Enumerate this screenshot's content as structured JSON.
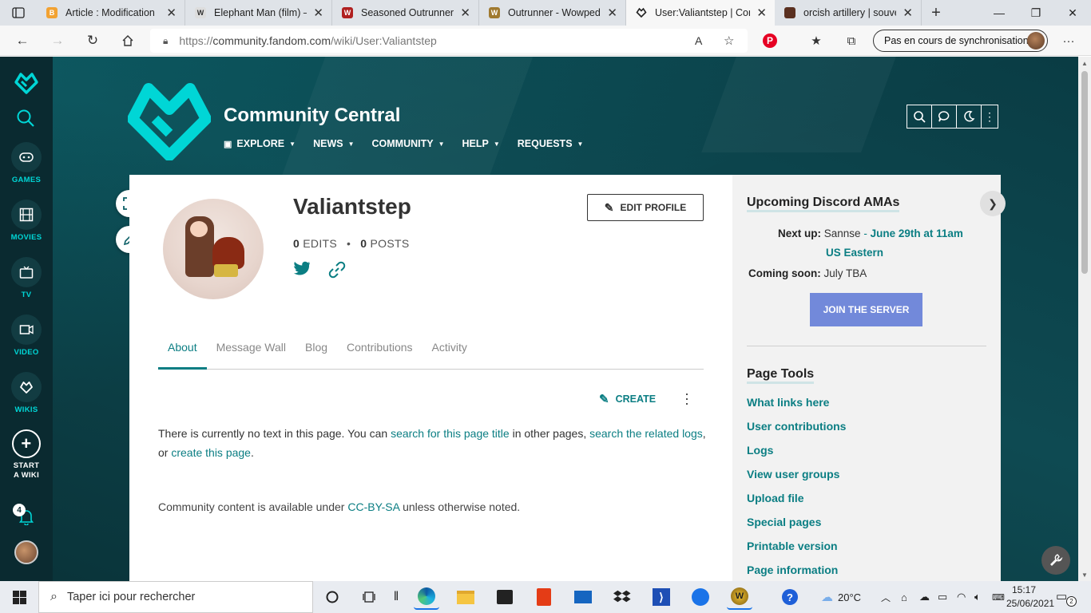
{
  "browser": {
    "tabs": [
      {
        "title": "Article : Modification",
        "favicon_color": "#f2a232"
      },
      {
        "title": "Elephant Man (film) — Wikipédia",
        "favicon_color": "#dddddd"
      },
      {
        "title": "Seasoned Outrunner - Wowpedia",
        "favicon_color": "#b02020"
      },
      {
        "title": "Outrunner - Wowpedia",
        "favicon_color": "#a07a30"
      },
      {
        "title": "User:Valiantstep | Community Central",
        "favicon_color": "#222222",
        "active": true
      },
      {
        "title": "orcish artillery | souvenirs",
        "favicon_color": "#5a3020"
      }
    ],
    "url_prefix": "https://",
    "url_host": "community.fandom.com",
    "url_path": "/wiki/User:Valiantstep",
    "sync_label": "Pas en cours de synchronisation"
  },
  "global_nav": {
    "items": [
      {
        "label": "GAMES",
        "icon": "gamepad-icon"
      },
      {
        "label": "MOVIES",
        "icon": "film-icon"
      },
      {
        "label": "TV",
        "icon": "tv-icon"
      },
      {
        "label": "VIDEO",
        "icon": "video-icon"
      },
      {
        "label": "WIKIS",
        "icon": "fandom-heart-icon"
      },
      {
        "label": "START A WIKI",
        "icon": "plus-icon"
      }
    ],
    "notifications_count": "4"
  },
  "community": {
    "title": "Community Central",
    "nav": [
      "EXPLORE",
      "NEWS",
      "COMMUNITY",
      "HELP",
      "REQUESTS"
    ]
  },
  "profile": {
    "username": "Valiantstep",
    "edits_count": "0",
    "edits_label": "EDITS",
    "posts_count": "0",
    "posts_label": "POSTS",
    "edit_profile_label": "EDIT PROFILE"
  },
  "tabs": [
    "About",
    "Message Wall",
    "Blog",
    "Contributions",
    "Activity"
  ],
  "content": {
    "create_label": "CREATE",
    "text_1": "There is currently no text in this page. You can ",
    "link_1": "search for this page title",
    "text_2": " in other pages, ",
    "link_2": "search the related logs",
    "text_3": ", or ",
    "link_3": "create this page",
    "text_4": ".",
    "license_pre": "Community content is available under ",
    "license_link": "CC-BY-SA",
    "license_post": " unless otherwise noted."
  },
  "rail": {
    "amas_title": "Upcoming Discord AMAs",
    "next_up_label": "Next up:",
    "next_up_name": "Sannse",
    "next_up_sep": " - ",
    "next_up_time_1": "June 29th at 11am",
    "next_up_time_2": "US Eastern",
    "coming_soon_label": "Coming soon:",
    "coming_soon_value": "July TBA",
    "join_label": "JOIN THE SERVER",
    "tools_title": "Page Tools",
    "tools": [
      "What links here",
      "User contributions",
      "Logs",
      "View user groups",
      "Upload file",
      "Special pages",
      "Printable version",
      "Page information"
    ]
  },
  "taskbar": {
    "search_placeholder": "Taper ici pour rechercher",
    "weather": "20°C",
    "time": "15:17",
    "date": "25/06/2021",
    "notif_count": "2"
  },
  "colors": {
    "fandom_teal": "#00d6d6",
    "link": "#0b7e83",
    "discord": "#7289da",
    "header_bg": "#0b3a41"
  }
}
